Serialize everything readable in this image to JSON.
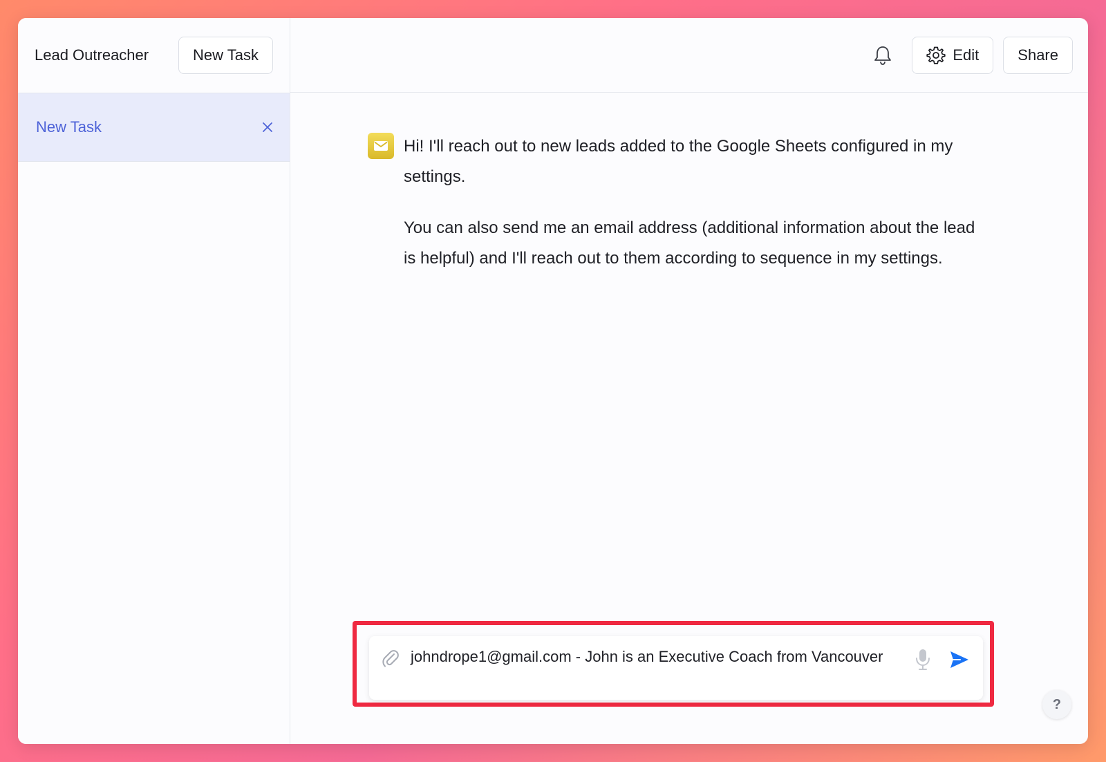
{
  "sidebar": {
    "app_title": "Lead Outreacher",
    "new_task_label": "New Task",
    "tasks": [
      {
        "label": "New Task",
        "active": true
      }
    ]
  },
  "topbar": {
    "bell_icon": "bell-icon",
    "edit_label": "Edit",
    "share_label": "Share"
  },
  "chat": {
    "messages": [
      {
        "sender": "assistant",
        "avatar_icon": "mail-icon",
        "paragraphs": [
          "Hi! I'll reach out to new leads added to the Google Sheets configured in my settings.",
          "You can also send me an email address (additional information about the lead is helpful) and I'll reach out to them according to sequence in my settings."
        ]
      }
    ]
  },
  "composer": {
    "value": "johndrope1@gmail.com - John is an Executive Coach from Vancouver"
  },
  "help_label": "?",
  "colors": {
    "accent": "#4e63d8",
    "active_task_bg": "#e8ebfb",
    "send": "#1a73f5",
    "highlight": "#ef2941",
    "avatar": "#e3c43a"
  }
}
